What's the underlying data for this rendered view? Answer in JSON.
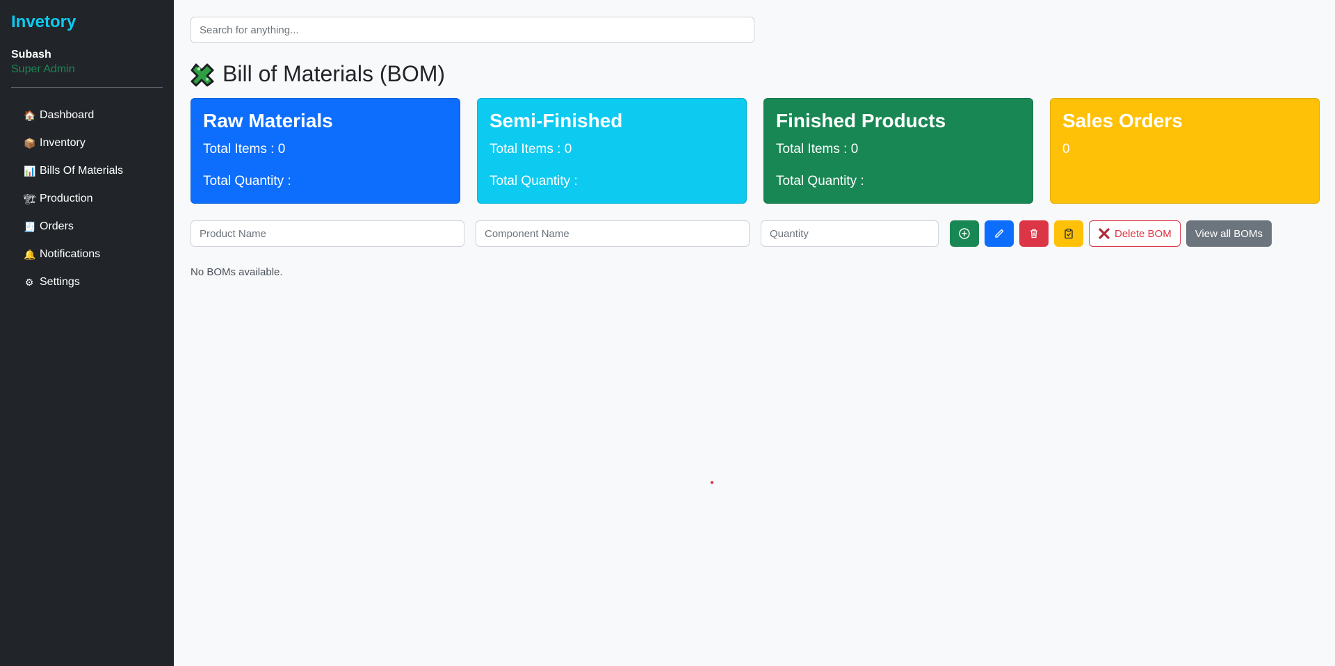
{
  "brand": "Invetory",
  "user": {
    "name": "Subash",
    "role": "Super Admin"
  },
  "nav": [
    {
      "icon": "home-icon",
      "glyph": "🏠",
      "label": "Dashboard"
    },
    {
      "icon": "box-icon",
      "glyph": "📦",
      "label": "Inventory"
    },
    {
      "icon": "chart-icon",
      "glyph": "📊",
      "label": "Bills Of Materials"
    },
    {
      "icon": "crane-icon",
      "glyph": "🏗",
      "label": "Production"
    },
    {
      "icon": "receipt-icon",
      "glyph": "🧾",
      "label": "Orders"
    },
    {
      "icon": "bell-icon",
      "glyph": "🔔",
      "label": "Notifications"
    },
    {
      "icon": "gear-icon",
      "glyph": "⚙",
      "label": "Settings"
    }
  ],
  "search": {
    "placeholder": "Search for anything..."
  },
  "page": {
    "title": "Bill of Materials (BOM)"
  },
  "cards": [
    {
      "title": "Raw Materials",
      "line1": "Total Items : 0",
      "line2": "Total Quantity :"
    },
    {
      "title": "Semi-Finished",
      "line1": "Total Items : 0",
      "line2": "Total Quantity :"
    },
    {
      "title": "Finished Products",
      "line1": "Total Items : 0",
      "line2": "Total Quantity :"
    },
    {
      "title": "Sales Orders",
      "line1": "0",
      "line2": ""
    }
  ],
  "form": {
    "product_placeholder": "Product Name",
    "component_placeholder": "Component Name",
    "quantity_placeholder": "Quantity",
    "delete_bom_label": "Delete BOM",
    "view_all_label": "View all BOMs"
  },
  "empty_message": "No BOMs available.",
  "colors": {
    "sidebar_bg": "#212529",
    "brand": "#0dcaf0",
    "role": "#198754",
    "primary": "#0d6efd",
    "info": "#0dcaf0",
    "success": "#198754",
    "warning": "#ffc107",
    "danger": "#dc3545",
    "secondary": "#6c757d"
  }
}
